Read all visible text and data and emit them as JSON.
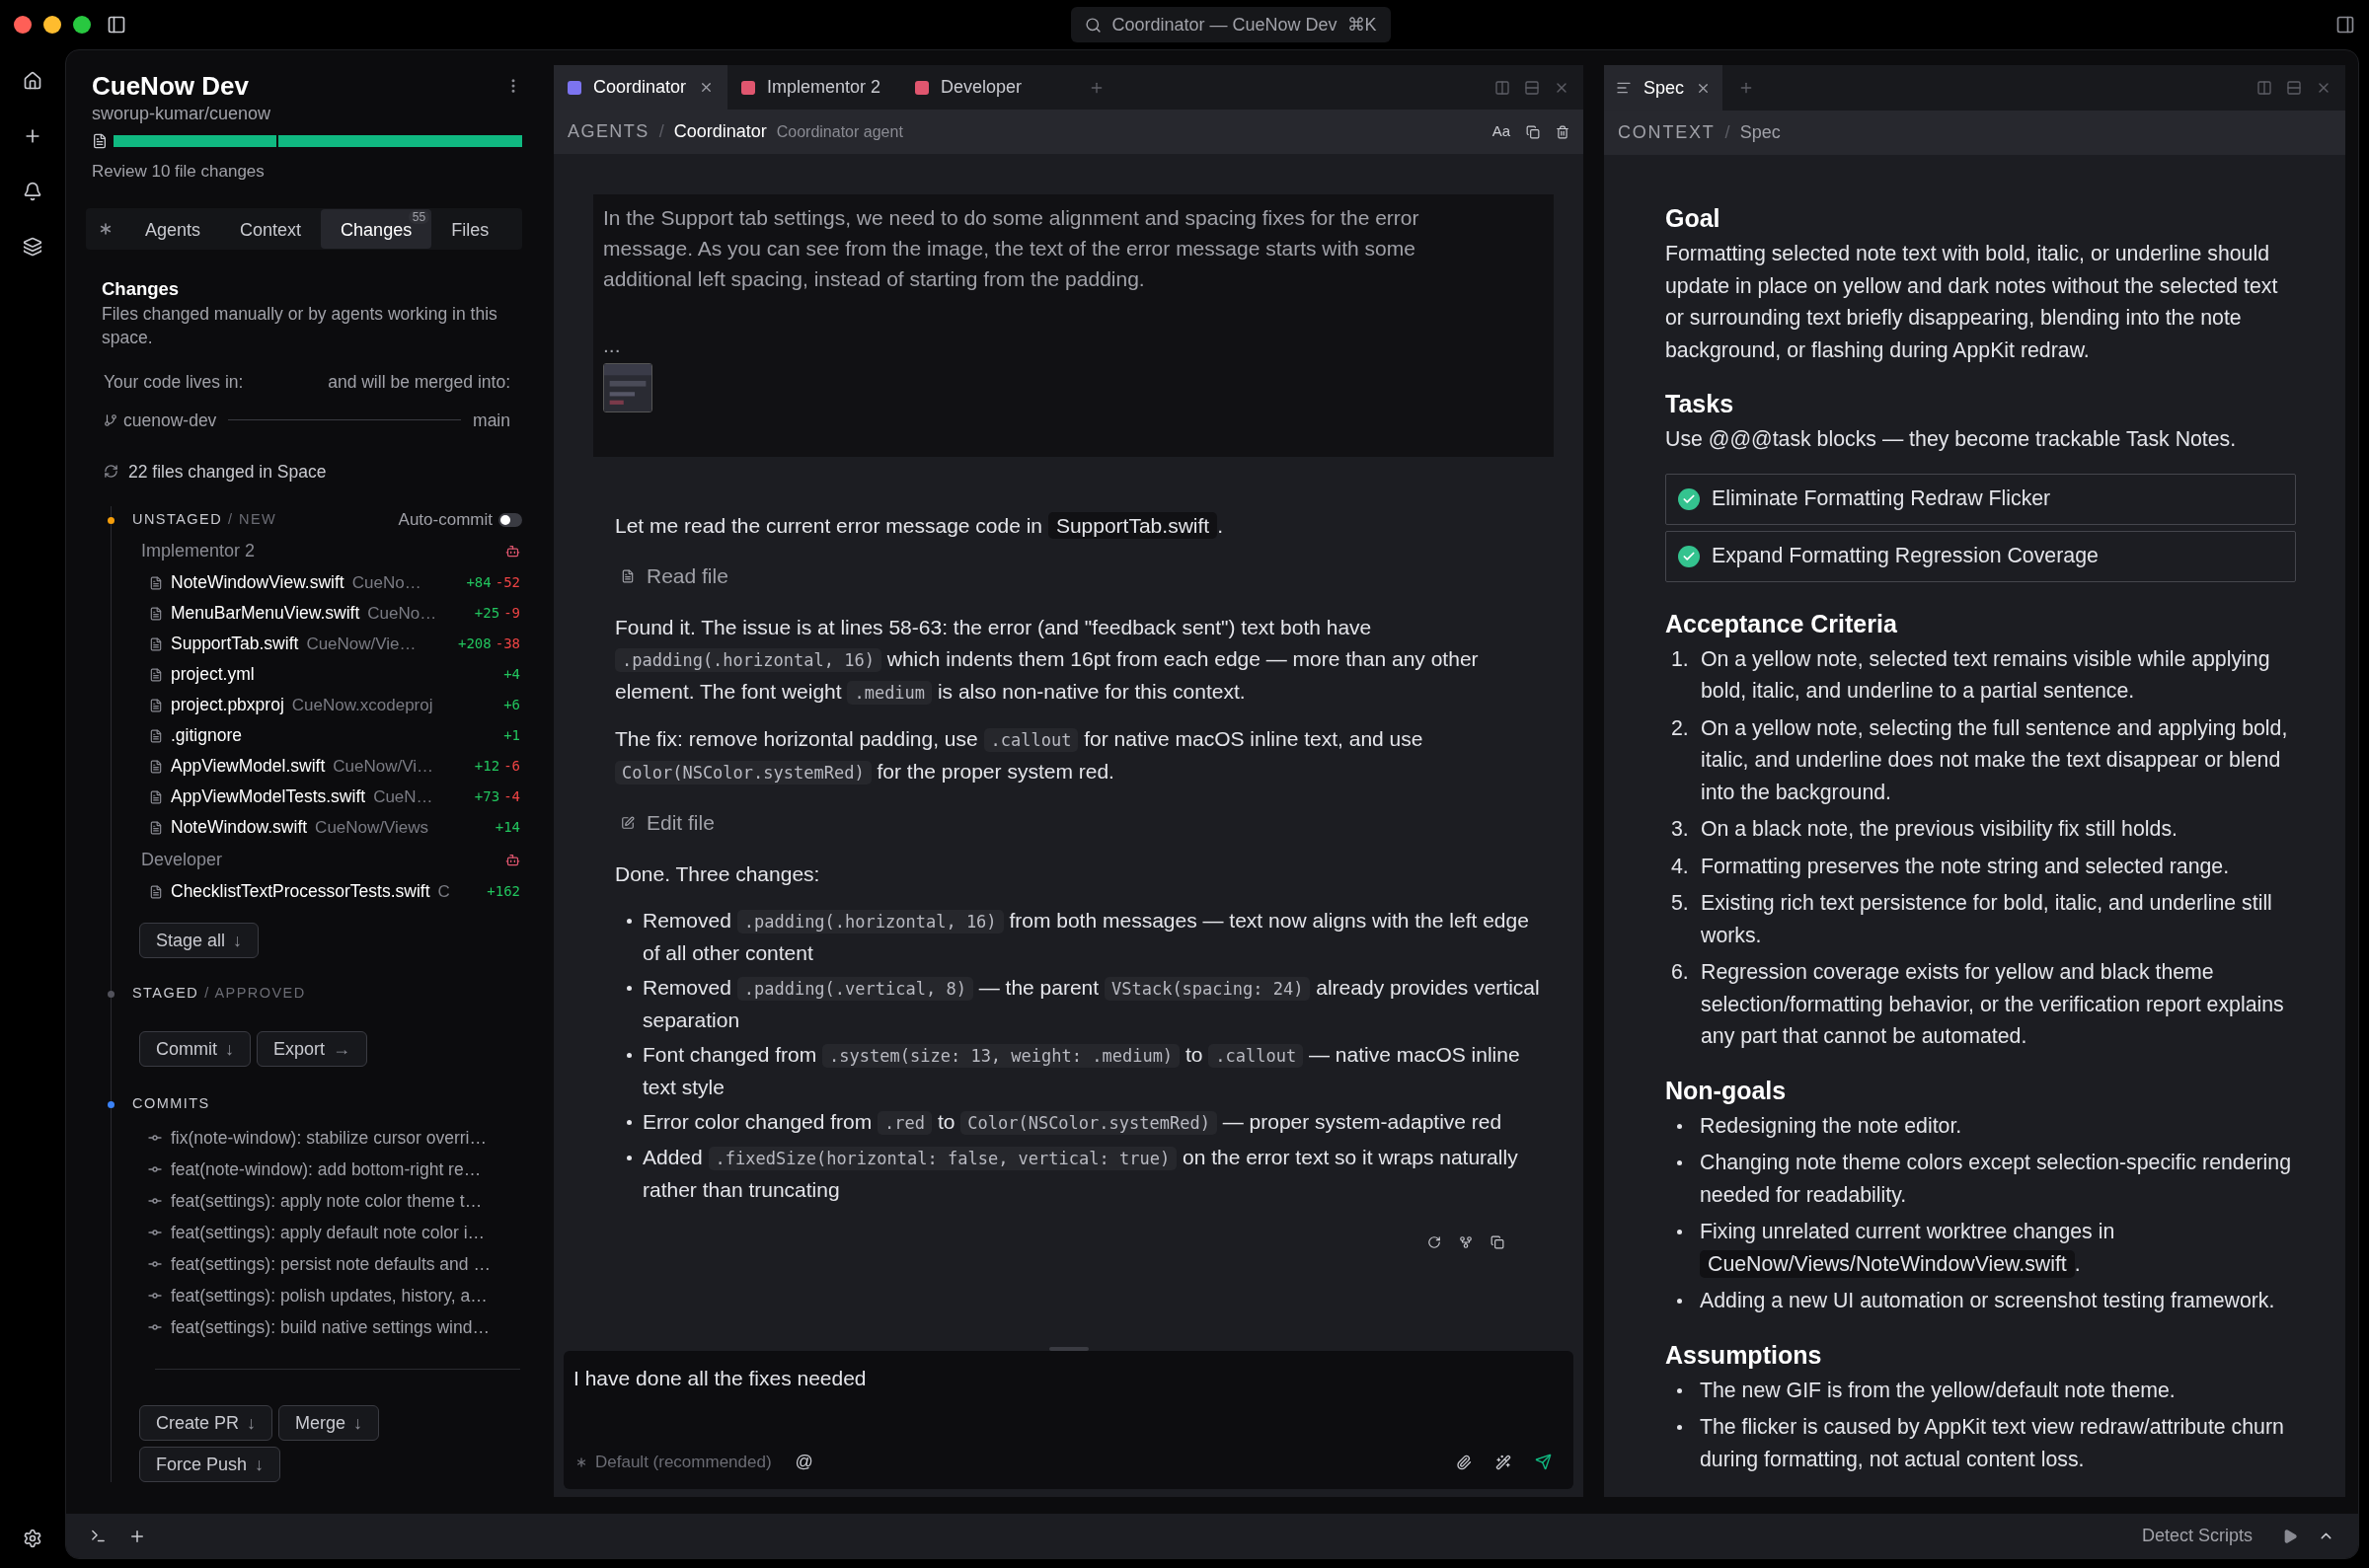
{
  "titlebar": {
    "search": "Coordinator — CueNow Dev",
    "shortcut": "⌘K"
  },
  "space": {
    "title": "CueNow Dev",
    "repo": "sworup-kumar/cuenow",
    "progress": [
      {
        "level": 0.4
      },
      {
        "level": 0.6
      }
    ],
    "review": "Review 10 file changes"
  },
  "sidebar_tabs": [
    {
      "kind": "icon",
      "selected": false
    },
    {
      "kind": "text",
      "label": "Agents",
      "selected": false
    },
    {
      "kind": "text",
      "label": "Context",
      "selected": false
    },
    {
      "kind": "text",
      "label": "Changes",
      "badge": "55",
      "selected": true
    },
    {
      "kind": "text",
      "label": "Files",
      "selected": false
    }
  ],
  "changes": {
    "title": "Changes",
    "description": "Files changed manually or by agents working in this space.",
    "lives_label": "Your code lives in:",
    "merge_label": "and will be merged into:",
    "branch": "cuenow-dev",
    "target": "main",
    "summary": "22 files changed in Space"
  },
  "unstaged": {
    "title": "UNSTAGED",
    "subtitle": "/ NEW",
    "color": "#f59e0b",
    "auto_commit": {
      "label": "Auto-commit",
      "on": false
    },
    "groups": [
      {
        "agent": "Implementor 2",
        "color": "#e0566f",
        "files": [
          {
            "name": "NoteWindowView.swift",
            "path": "CueNo…",
            "added": "+84",
            "removed": "-52"
          },
          {
            "name": "MenuBarMenuView.swift",
            "path": "CueNo…",
            "added": "+25",
            "removed": "-9"
          },
          {
            "name": "SupportTab.swift",
            "path": "CueNow/Vie…",
            "added": "+208",
            "removed": "-38"
          },
          {
            "name": "project.yml",
            "added": "+4"
          },
          {
            "name": "project.pbxproj",
            "path": "CueNow.xcodeproj",
            "added": "+6"
          },
          {
            "name": ".gitignore",
            "added": "+1"
          },
          {
            "name": "AppViewModel.swift",
            "path": "CueNow/Vi…",
            "added": "+12",
            "removed": "-6"
          },
          {
            "name": "AppViewModelTests.swift",
            "path": "CueN…",
            "added": "+73",
            "removed": "-4"
          },
          {
            "name": "NoteWindow.swift",
            "path": "CueNow/Views",
            "added": "+14"
          }
        ]
      },
      {
        "agent": "Developer",
        "color": "#e0566f",
        "files": [
          {
            "name": "ChecklistTextProcessorTests.swift",
            "path": "C",
            "added": "+162"
          }
        ]
      }
    ],
    "buttons": [
      {
        "label": "Stage all",
        "arrow": "↓"
      }
    ]
  },
  "staged": {
    "title": "STAGED",
    "subtitle": "/ APPROVED",
    "color": "#52525b",
    "buttons": [
      {
        "label": "Commit",
        "arrow": "↓"
      },
      {
        "label": "Export",
        "arrow": "→"
      }
    ]
  },
  "commits": {
    "title": "COMMITS",
    "color": "#3b82f6",
    "items": [
      "fix(note-window): stabilize cursor overri…",
      "feat(note-window): add bottom-right re…",
      "feat(settings): apply note color theme t…",
      "feat(settings): apply default note color i…",
      "feat(settings): persist note defaults and …",
      "feat(settings): polish updates, history, a…",
      "feat(settings): build native settings wind…"
    ],
    "buttons": [
      {
        "label": "Create PR",
        "arrow": "↓"
      },
      {
        "label": "Merge",
        "arrow": "↓"
      },
      {
        "label": "Force Push",
        "arrow": "↓"
      }
    ]
  },
  "chat": {
    "tabs": [
      {
        "label": "Coordinator",
        "color": "#7c74f0",
        "selected": true
      },
      {
        "label": "Implementor 2",
        "color": "#e0566f",
        "selected": false
      },
      {
        "label": "Developer",
        "color": "#e0566f",
        "selected": false
      }
    ],
    "breadcrumb": {
      "section": "AGENTS",
      "separator": "/",
      "title": "Coordinator",
      "subtitle": "Coordinator agent"
    },
    "text_size": "Aa",
    "quote": {
      "text": "In the Support tab settings, we need to do some alignment and spacing fixes for the error message. As you can see from the image, the text of the error message starts with some additional left spacing, instead of starting from the padding.",
      "more": "..."
    },
    "blocks": [
      {
        "kind": "paragraph",
        "segments": [
          {
            "text": "Let me read the current error message code in "
          },
          {
            "code": "SupportTab.swift",
            "kind": "file"
          },
          {
            "text": "."
          }
        ]
      },
      {
        "kind": "read",
        "label": "Read file"
      },
      {
        "kind": "paragraph",
        "segments": [
          {
            "text": "Found it. The issue is at lines 58-63: the error (and \"feedback sent\") text both have "
          },
          {
            "code": ".padding(.horizontal, 16)"
          },
          {
            "text": " which indents them 16pt from each edge — more than any other element. The font weight "
          },
          {
            "code": ".medium"
          },
          {
            "text": " is also non-native for this context."
          }
        ]
      },
      {
        "kind": "paragraph",
        "segments": [
          {
            "text": "The fix: remove horizontal padding, use "
          },
          {
            "code": ".callout"
          },
          {
            "text": " for native macOS inline text, and use "
          },
          {
            "code": "Color(NSColor.systemRed)"
          },
          {
            "text": " for the proper system red."
          }
        ]
      },
      {
        "kind": "edit",
        "label": "Edit file"
      },
      {
        "kind": "paragraph",
        "segments": [
          {
            "text": "Done. Three changes:"
          }
        ]
      },
      {
        "kind": "list",
        "items": [
          [
            {
              "text": "Removed "
            },
            {
              "code": ".padding(.horizontal, 16)"
            },
            {
              "text": " from both messages — text now aligns with the left edge of all other content"
            }
          ],
          [
            {
              "text": "Removed "
            },
            {
              "code": ".padding(.vertical, 8)"
            },
            {
              "text": " — the parent "
            },
            {
              "code": "VStack(spacing: 24)"
            },
            {
              "text": " already provides vertical separation"
            }
          ],
          [
            {
              "text": "Font changed from "
            },
            {
              "code": ".system(size: 13, weight: .medium)"
            },
            {
              "text": " to "
            },
            {
              "code": ".callout"
            },
            {
              "text": " — native macOS inline text style"
            }
          ],
          [
            {
              "text": "Error color changed from "
            },
            {
              "code": ".red"
            },
            {
              "text": " to "
            },
            {
              "code": "Color(NSColor.systemRed)"
            },
            {
              "text": " — proper system-adaptive red"
            }
          ],
          [
            {
              "text": "Added "
            },
            {
              "code": ".fixedSize(horizontal: false, vertical: true)"
            },
            {
              "text": " on the error text so it wraps naturally rather than truncating"
            }
          ]
        ]
      }
    ],
    "composer": {
      "value": "I have done all the fixes needed",
      "model": "Default (recommended)",
      "mention": "@"
    }
  },
  "spec": {
    "tabs": [
      {
        "label": "Spec",
        "selected": true
      }
    ],
    "breadcrumb": {
      "section": "CONTEXT",
      "separator": "/",
      "title": "Spec"
    },
    "sections": [
      {
        "heading": "Goal",
        "kind": "paragraph",
        "text": "Formatting selected note text with bold, italic, or underline should update in place on yellow and dark notes without the selected text or surrounding text briefly disappearing, blending into the note background, or flashing during AppKit redraw."
      },
      {
        "heading": "Tasks",
        "kind": "tasks",
        "text": "Use @@@task blocks — they become trackable Task Notes.",
        "tasks": [
          {
            "label": "Eliminate Formatting Redraw Flicker",
            "done": true
          },
          {
            "label": "Expand Formatting Regression Coverage",
            "done": true
          }
        ]
      },
      {
        "heading": "Acceptance Criteria",
        "kind": "ordered",
        "items": [
          {
            "number": "1.",
            "text": "On a yellow note, selected text remains visible while applying bold, italic, and underline to a partial sentence."
          },
          {
            "number": "2.",
            "text": "On a yellow note, selecting the full sentence and applying bold, italic, and underline does not make the text disappear or blend into the background."
          },
          {
            "number": "3.",
            "text": "On a black note, the previous visibility fix still holds."
          },
          {
            "number": "4.",
            "text": "Formatting preserves the note string and selected range."
          },
          {
            "number": "5.",
            "text": "Existing rich text persistence for bold, italic, and underline still works."
          },
          {
            "number": "6.",
            "text": "Regression coverage exists for yellow and black theme selection/formatting behavior, or the verification report explains any part that cannot be automated."
          }
        ]
      },
      {
        "heading": "Non-goals",
        "kind": "bullets",
        "items": [
          [
            {
              "text": "Redesigning the note editor."
            }
          ],
          [
            {
              "text": "Changing note theme colors except selection-specific rendering needed for readability."
            }
          ],
          [
            {
              "text": "Fixing unrelated current worktree changes in "
            },
            {
              "code": "CueNow/Views/NoteWindowView.swift",
              "kind": "file"
            },
            {
              "text": "."
            }
          ],
          [
            {
              "text": "Adding a new UI automation or screenshot testing framework."
            }
          ]
        ]
      },
      {
        "heading": "Assumptions",
        "kind": "bullets",
        "items": [
          [
            {
              "text": "The new GIF is from the yellow/default note theme."
            }
          ],
          [
            {
              "text": "The flicker is caused by AppKit text view redraw/attribute churn during formatting, not actual content loss."
            }
          ]
        ]
      }
    ]
  },
  "status_bar": {
    "scripts": "Detect Scripts"
  }
}
